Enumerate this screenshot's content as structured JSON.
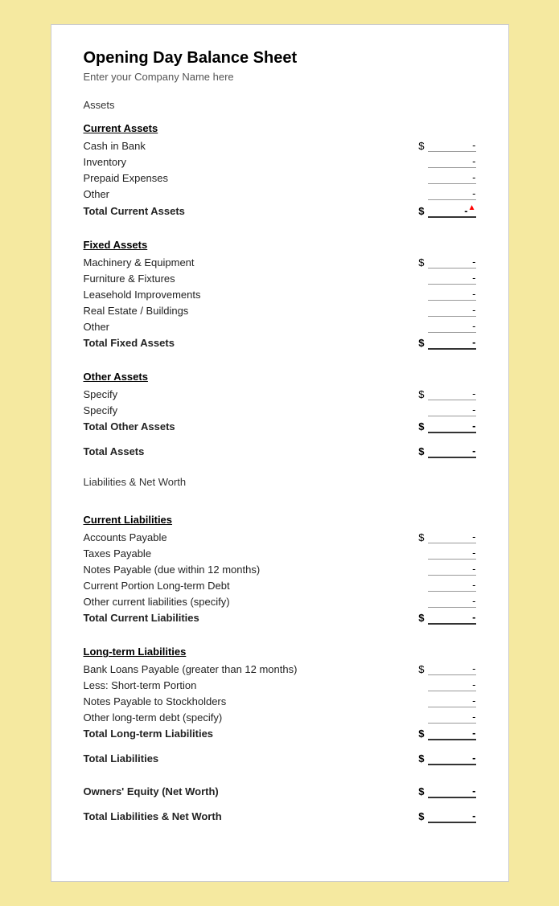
{
  "title": "Opening Day Balance Sheet",
  "subtitle": "Enter your Company Name here",
  "sections": {
    "assets_label": "Assets",
    "current_assets": {
      "header": "Current Assets",
      "items": [
        {
          "label": "Cash in Bank",
          "dollar": "$",
          "value": "-"
        },
        {
          "label": "Inventory",
          "dollar": "",
          "value": "-"
        },
        {
          "label": "Prepaid Expenses",
          "dollar": "",
          "value": "-"
        },
        {
          "label": "Other",
          "dollar": "",
          "value": "-"
        }
      ],
      "total_label": "Total Current Assets",
      "total_dollar": "$",
      "total_value": "-"
    },
    "fixed_assets": {
      "header": "Fixed Assets",
      "items": [
        {
          "label": "Machinery & Equipment",
          "dollar": "$",
          "value": "-"
        },
        {
          "label": "Furniture & Fixtures",
          "dollar": "",
          "value": "-"
        },
        {
          "label": "Leasehold Improvements",
          "dollar": "",
          "value": "-"
        },
        {
          "label": "Real Estate / Buildings",
          "dollar": "",
          "value": "-"
        },
        {
          "label": "Other",
          "dollar": "",
          "value": "-"
        }
      ],
      "total_label": "Total Fixed Assets",
      "total_dollar": "$",
      "total_value": "-"
    },
    "other_assets": {
      "header": "Other Assets",
      "items": [
        {
          "label": "Specify",
          "dollar": "$",
          "value": "-"
        },
        {
          "label": "Specify",
          "dollar": "",
          "value": "-"
        }
      ],
      "total_label": "Total Other Assets",
      "total_dollar": "$",
      "total_value": "-"
    },
    "total_assets": {
      "label": "Total Assets",
      "dollar": "$",
      "value": "-"
    },
    "liabilities_label": "Liabilities & Net Worth",
    "current_liabilities": {
      "header": "Current Liabilities",
      "items": [
        {
          "label": "Accounts Payable",
          "dollar": "$",
          "value": "-"
        },
        {
          "label": "Taxes Payable",
          "dollar": "",
          "value": "-"
        },
        {
          "label": "Notes Payable (due within 12 months)",
          "dollar": "",
          "value": "-"
        },
        {
          "label": "Current Portion Long-term Debt",
          "dollar": "",
          "value": "-"
        },
        {
          "label": "Other current liabilities (specify)",
          "dollar": "",
          "value": "-"
        }
      ],
      "total_label": "Total Current Liabilities",
      "total_dollar": "$",
      "total_value": "-"
    },
    "longterm_liabilities": {
      "header": "Long-term Liabilities",
      "items": [
        {
          "label": "Bank Loans Payable (greater than 12 months)",
          "dollar": "$",
          "value": "-"
        },
        {
          "label": "Less: Short-term Portion",
          "dollar": "",
          "value": "-"
        },
        {
          "label": "Notes Payable to Stockholders",
          "dollar": "",
          "value": "-"
        },
        {
          "label": "Other long-term debt (specify)",
          "dollar": "",
          "value": "-"
        }
      ],
      "total_label": "Total Long-term Liabilities",
      "total_dollar": "$",
      "total_value": "-"
    },
    "total_liabilities": {
      "label": "Total Liabilities",
      "dollar": "$",
      "value": "-"
    },
    "owners_equity": {
      "label": "Owners' Equity (Net Worth)",
      "dollar": "$",
      "value": "-"
    },
    "total_liabilities_networth": {
      "label": "Total Liabilities & Net Worth",
      "dollar": "$",
      "value": "-"
    }
  }
}
